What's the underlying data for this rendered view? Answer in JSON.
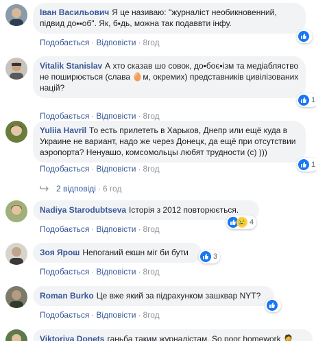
{
  "labels": {
    "like": "Подобається",
    "reply": "Відповісти",
    "sep": "·"
  },
  "comments": [
    {
      "author": "Іван Васильович",
      "text": "Я це називаю: \"журналіст необикновенний, підвид до▪▪об\". Як, б▪дь, можна так подаввти інфу.",
      "time": "8год",
      "reaction_count": "",
      "reaction_type": "like"
    },
    {
      "author": "Vitalik Stanislav",
      "text": "А хто сказав шо совок, до▪боє▪ізм та медіабляство не поширюється (слава 🥚м, окремих) представників цивілізованих націй?",
      "time": "8год",
      "reaction_count": "1",
      "reaction_type": "like"
    },
    {
      "author": "Yuliia Havril",
      "text": "То есть прилететь в Харьков, Днепр или ещё куда в Украине не вариант, надо же через Донецк, да ещё при отсутствии аэропорта? Ненуашо, комсомольцы любят трудности (с) )))",
      "time": "8год",
      "reaction_count": "1",
      "reaction_type": "like"
    },
    {
      "author": "Nadiya Starodubtseva",
      "text": "Історія з 2012 повторюється.",
      "time": "8год",
      "reaction_count": "4",
      "reaction_type": "like-sad"
    },
    {
      "author": "Зоя Ярош",
      "text": "Непоганий екшн міг би бути",
      "time": "8год",
      "reaction_count": "3",
      "reaction_type": "like"
    },
    {
      "author": "Roman Burko",
      "text": "Це вже який за підрахунком зашквар NYT?",
      "time": "8год",
      "reaction_count": "",
      "reaction_type": "like"
    },
    {
      "author": "Viktoriya Donets",
      "text": "ганьба таким журналістам. So poor homework 🤦",
      "time": "",
      "reaction_count": "",
      "reaction_type": ""
    }
  ],
  "replies": {
    "label": "2 відповіді",
    "time": "6 год"
  },
  "colors": {
    "author": "#385898",
    "bubble": "#f2f3f5",
    "meta": "#606770",
    "like": "#1877f2"
  }
}
